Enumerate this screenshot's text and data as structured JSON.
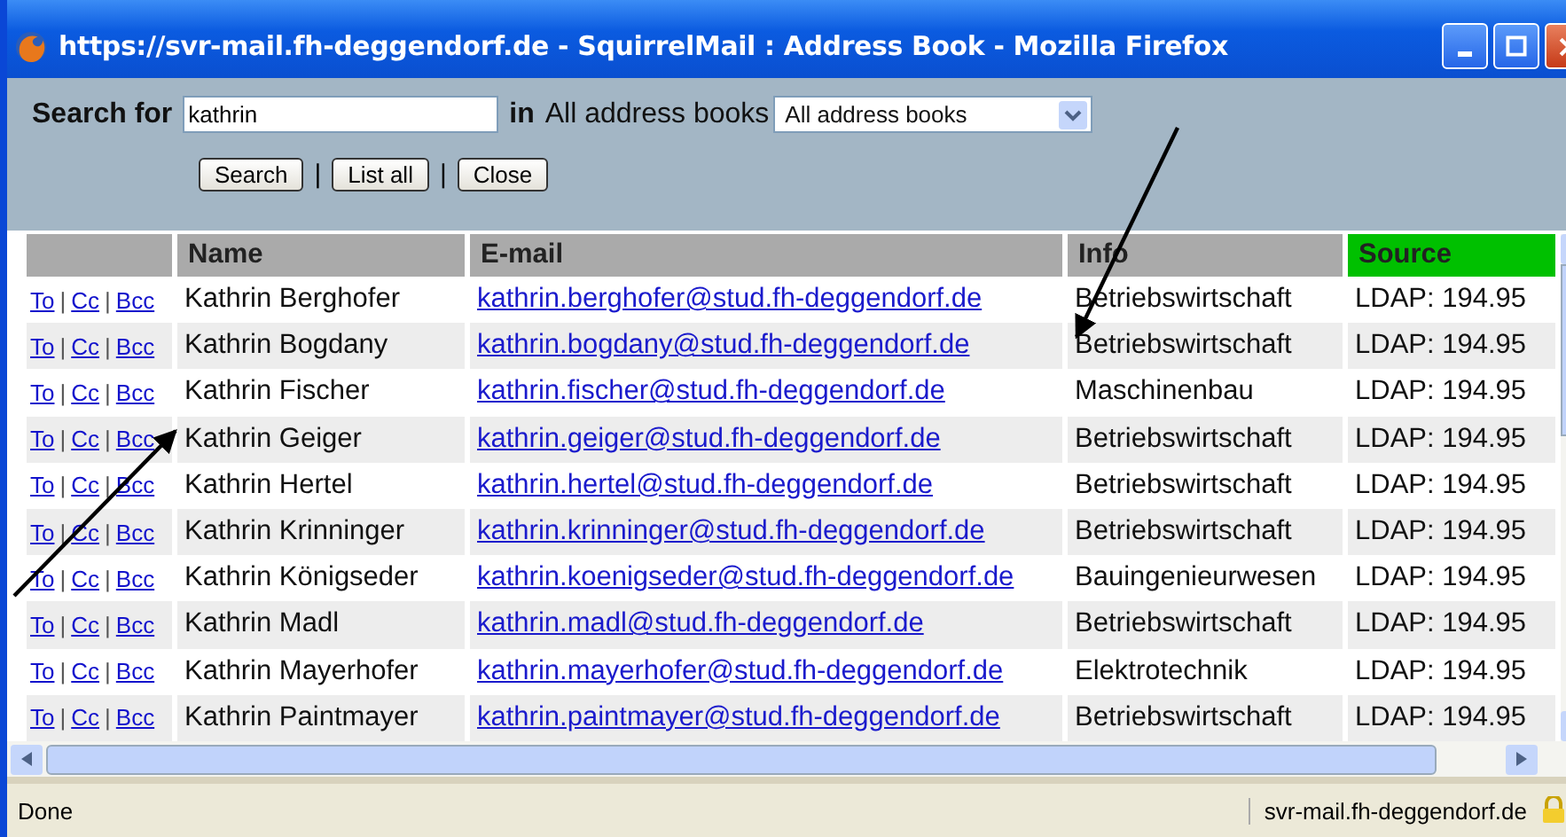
{
  "window": {
    "title": "https://svr-mail.fh-deggendorf.de - SquirrelMail : Address Book - Mozilla Firefox"
  },
  "search": {
    "label": "Search for",
    "value": "kathrin",
    "in_label": "in",
    "scope_label": "All address books",
    "scope_value": "All address books"
  },
  "buttons": [
    {
      "kind": "button",
      "label": "Search"
    },
    {
      "kind": "separator",
      "label": "|"
    },
    {
      "kind": "button",
      "label": "List all"
    },
    {
      "kind": "separator",
      "label": "|"
    },
    {
      "kind": "button",
      "label": "Close"
    }
  ],
  "table": {
    "columns": [
      {
        "highlighted": false
      },
      {
        "label": "Name",
        "highlighted": false
      },
      {
        "label": "E-mail",
        "highlighted": false
      },
      {
        "label": "Info",
        "highlighted": false
      },
      {
        "label": "Source",
        "highlighted": true
      }
    ],
    "rows": [
      {
        "to": "To",
        "sep1": "|",
        "cc": "Cc",
        "sep2": "|",
        "bcc": "Bcc",
        "name": "Kathrin Berghofer",
        "email": "kathrin.berghofer@stud.fh-deggendorf.de",
        "info": "Betriebswirtschaft",
        "source": "LDAP: 194.95"
      },
      {
        "to": "To",
        "sep1": "|",
        "cc": "Cc",
        "sep2": "|",
        "bcc": "Bcc",
        "name": "Kathrin Bogdany",
        "email": "kathrin.bogdany@stud.fh-deggendorf.de",
        "info": "Betriebswirtschaft",
        "source": "LDAP: 194.95"
      },
      {
        "to": "To",
        "sep1": "|",
        "cc": "Cc",
        "sep2": "|",
        "bcc": "Bcc",
        "name": "Kathrin Fischer",
        "email": "kathrin.fischer@stud.fh-deggendorf.de",
        "info": "Maschinenbau",
        "source": "LDAP: 194.95"
      },
      {
        "to": "To",
        "sep1": "|",
        "cc": "Cc",
        "sep2": "|",
        "bcc": "Bcc",
        "name": "Kathrin Geiger",
        "email": "kathrin.geiger@stud.fh-deggendorf.de",
        "info": "Betriebswirtschaft",
        "source": "LDAP: 194.95"
      },
      {
        "to": "To",
        "sep1": "|",
        "cc": "Cc",
        "sep2": "|",
        "bcc": "Bcc",
        "name": "Kathrin Hertel",
        "email": "kathrin.hertel@stud.fh-deggendorf.de",
        "info": "Betriebswirtschaft",
        "source": "LDAP: 194.95"
      },
      {
        "to": "To",
        "sep1": "|",
        "cc": "Cc",
        "sep2": "|",
        "bcc": "Bcc",
        "name": "Kathrin Krinninger",
        "email": "kathrin.krinninger@stud.fh-deggendorf.de",
        "info": "Betriebswirtschaft",
        "source": "LDAP: 194.95"
      },
      {
        "to": "To",
        "sep1": "|",
        "cc": "Cc",
        "sep2": "|",
        "bcc": "Bcc",
        "name": "Kathrin Königseder",
        "email": "kathrin.koenigseder@stud.fh-deggendorf.de",
        "info": "Bauingenieurwesen",
        "source": "LDAP: 194.95"
      },
      {
        "to": "To",
        "sep1": "|",
        "cc": "Cc",
        "sep2": "|",
        "bcc": "Bcc",
        "name": "Kathrin Madl",
        "email": "kathrin.madl@stud.fh-deggendorf.de",
        "info": "Betriebswirtschaft",
        "source": "LDAP: 194.95"
      },
      {
        "to": "To",
        "sep1": "|",
        "cc": "Cc",
        "sep2": "|",
        "bcc": "Bcc",
        "name": "Kathrin Mayerhofer",
        "email": "kathrin.mayerhofer@stud.fh-deggendorf.de",
        "info": "Elektrotechnik",
        "source": "LDAP: 194.95"
      },
      {
        "to": "To",
        "sep1": "|",
        "cc": "Cc",
        "sep2": "|",
        "bcc": "Bcc",
        "name": "Kathrin Paintmayer",
        "email": "kathrin.paintmayer@stud.fh-deggendorf.de",
        "info": "Betriebswirtschaft",
        "source": "LDAP: 194.95"
      }
    ]
  },
  "status_bar": {
    "text": "Done",
    "host": "svr-mail.fh-deggendorf.de"
  }
}
